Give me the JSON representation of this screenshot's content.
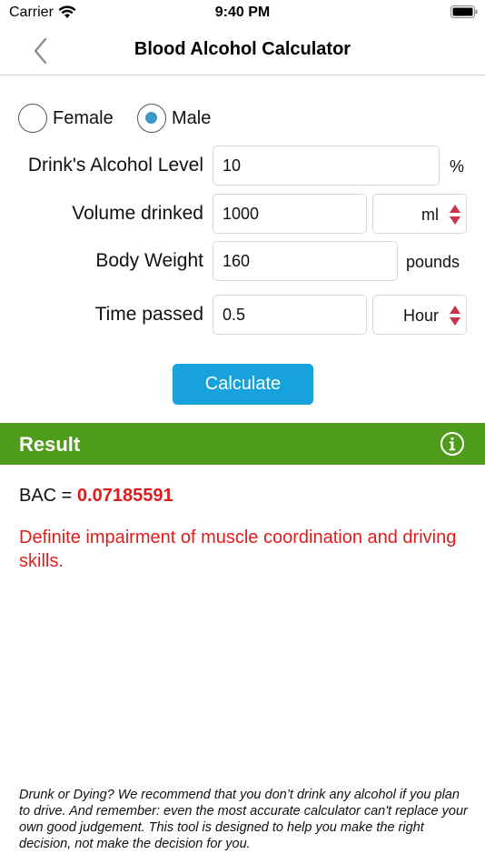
{
  "status_bar": {
    "carrier": "Carrier",
    "time": "9:40 PM"
  },
  "nav": {
    "title": "Blood Alcohol Calculator",
    "back_icon": "chevron-left-icon"
  },
  "gender": {
    "options": [
      {
        "label": "Female",
        "selected": false
      },
      {
        "label": "Male",
        "selected": true
      }
    ]
  },
  "form": {
    "alcohol_level": {
      "label": "Drink's Alcohol Level",
      "value": "10",
      "unit": "%"
    },
    "volume": {
      "label": "Volume drinked",
      "value": "1000",
      "unit": "ml"
    },
    "weight": {
      "label": "Body Weight",
      "value": "160",
      "unit": "pounds"
    },
    "time": {
      "label": "Time passed",
      "value": "0.5",
      "unit": "Hour"
    }
  },
  "calculate_label": "Calculate",
  "result": {
    "title": "Result",
    "bac_prefix": "BAC = ",
    "bac_value": "0.07185591",
    "message": "Definite impairment of muscle coordination and driving skills."
  },
  "disclaimer": "Drunk or Dying? We recommend that you don’t drink any alcohol if you plan to drive. And remember: even the most accurate calculator can't replace your own good judgement. This tool is designed to help you make the right decision, not make the decision for you.",
  "colors": {
    "accent_blue": "#17a2dc",
    "result_green": "#4f9b1a",
    "alert_red": "#e21b1b",
    "radio_blue": "#3a98c4"
  }
}
